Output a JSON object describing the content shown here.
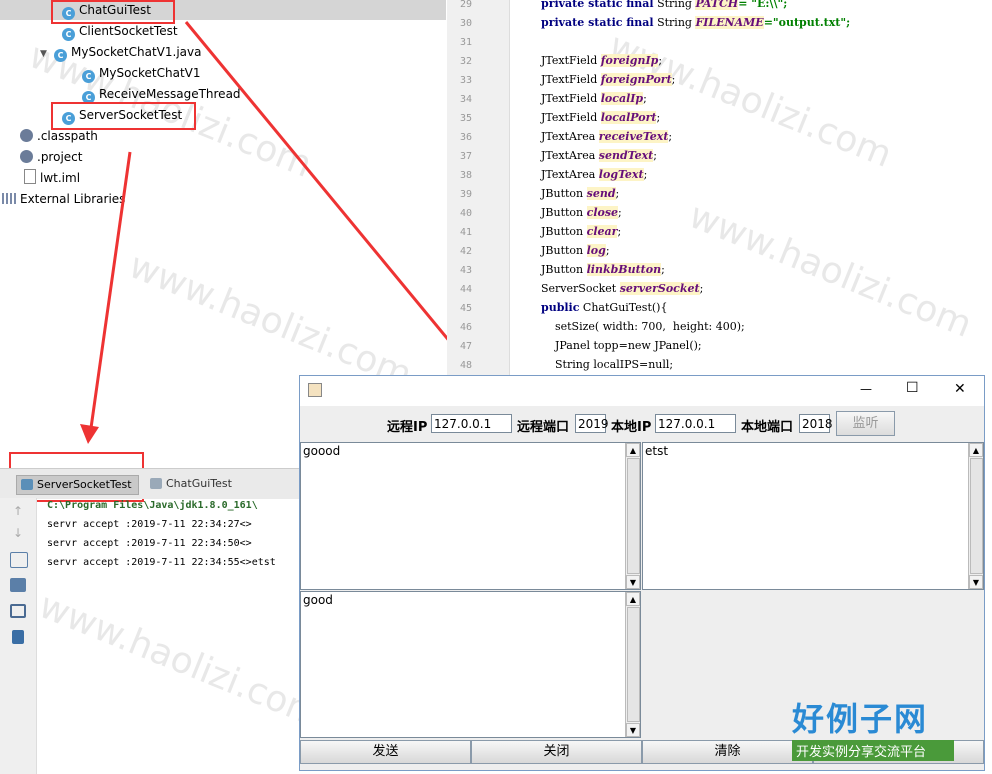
{
  "project_tree": {
    "items": [
      {
        "label": "ChatGuiTest",
        "type": "class"
      },
      {
        "label": "ClientSocketTest",
        "type": "class"
      },
      {
        "label": "MySocketChatV1.java",
        "type": "class"
      },
      {
        "label": "MySocketChatV1",
        "type": "class"
      },
      {
        "label": "ReceiveMessageThread",
        "type": "class"
      },
      {
        "label": "ServerSocketTest",
        "type": "class"
      },
      {
        "label": ".classpath",
        "type": "file"
      },
      {
        "label": ".project",
        "type": "file"
      },
      {
        "label": "lwt.iml",
        "type": "file"
      },
      {
        "label": "External Libraries",
        "type": "library"
      }
    ]
  },
  "editor": {
    "line_numbers": [
      "29",
      "30",
      "31",
      "32",
      "33",
      "34",
      "35",
      "36",
      "37",
      "38",
      "39",
      "40",
      "41",
      "42",
      "43",
      "44",
      "45",
      "46",
      "47",
      "48"
    ],
    "lines": [
      {
        "kw": "private static final",
        "rest": " String ",
        "fld": "PATCH",
        "tail": "= \"E:\\\\\";"
      },
      {
        "kw": "private static final",
        "rest": " String ",
        "fld": "FILENAME",
        "tail": "=\"output.txt\";"
      },
      {
        "kw": "",
        "rest": "",
        "fld": "",
        "tail": ""
      },
      {
        "kw": "",
        "rest": "JTextField ",
        "fld": "foreignIp",
        "tail": ";"
      },
      {
        "kw": "",
        "rest": "JTextField ",
        "fld": "foreignPort",
        "tail": ";"
      },
      {
        "kw": "",
        "rest": "JTextField ",
        "fld": "localIp",
        "tail": ";"
      },
      {
        "kw": "",
        "rest": "JTextField ",
        "fld": "localPort",
        "tail": ";"
      },
      {
        "kw": "",
        "rest": "JTextArea ",
        "fld": "receiveText",
        "tail": ";"
      },
      {
        "kw": "",
        "rest": "JTextArea ",
        "fld": "sendText",
        "tail": ";"
      },
      {
        "kw": "",
        "rest": "JTextArea ",
        "fld": "logText",
        "tail": ";"
      },
      {
        "kw": "",
        "rest": "JButton ",
        "fld": "send",
        "tail": ";"
      },
      {
        "kw": "",
        "rest": "JButton ",
        "fld": "close",
        "tail": ";"
      },
      {
        "kw": "",
        "rest": "JButton ",
        "fld": "clear",
        "tail": ";"
      },
      {
        "kw": "",
        "rest": "JButton ",
        "fld": "log",
        "tail": ";"
      },
      {
        "kw": "",
        "rest": "JButton ",
        "fld": "linkbButton",
        "tail": ";"
      },
      {
        "kw": "",
        "rest": "ServerSocket ",
        "fld": "serverSocket",
        "tail": ";"
      },
      {
        "kw": "public",
        "rest": " ChatGuiTest(){",
        "fld": "",
        "tail": ""
      },
      {
        "kw": "",
        "rest": "    setSize( width: 700,  height: 400);",
        "fld": "",
        "tail": ""
      },
      {
        "kw": "",
        "rest": "    JPanel topp=",
        "fld": "",
        "tail": "new JPanel();"
      },
      {
        "kw": "",
        "rest": "    String localIPS=",
        "fld": "",
        "tail": "null;"
      }
    ]
  },
  "run_panel": {
    "tabs": [
      "ServerSocketTest",
      "ChatGuiTest"
    ],
    "console_lines": [
      "C:\\Program Files\\Java\\jdk1.8.0_161\\",
      "servr accept :2019-7-11 22:34:27<>",
      "servr accept :2019-7-11 22:34:50<>",
      "servr accept :2019-7-11 22:34:55<>etst"
    ]
  },
  "java_window": {
    "remote_ip_label": "远程IP",
    "remote_ip_value": "127.0.0.1",
    "remote_port_label": "远程端口",
    "remote_port_value": "2019",
    "local_ip_label": "本地IP",
    "local_ip_value": "127.0.0.1",
    "local_port_label": "本地端口",
    "local_port_value": "2018",
    "listen_button": "监听",
    "receive_text": "goood",
    "log_text": "etst",
    "send_text": "good",
    "send_button": "发送",
    "close_button": "关闭",
    "clear_button": "清除",
    "minimize": "—",
    "maximize": "☐",
    "close": "✕"
  },
  "watermark": {
    "text": "www.haolizi.com",
    "logo_title": "好例子网",
    "logo_subtitle": "开发实例分享交流平台"
  },
  "colors": {
    "annotation_red": "#e33333",
    "selection": "#d5d5d5",
    "keyword": "#000080",
    "field": "#660e7a"
  }
}
